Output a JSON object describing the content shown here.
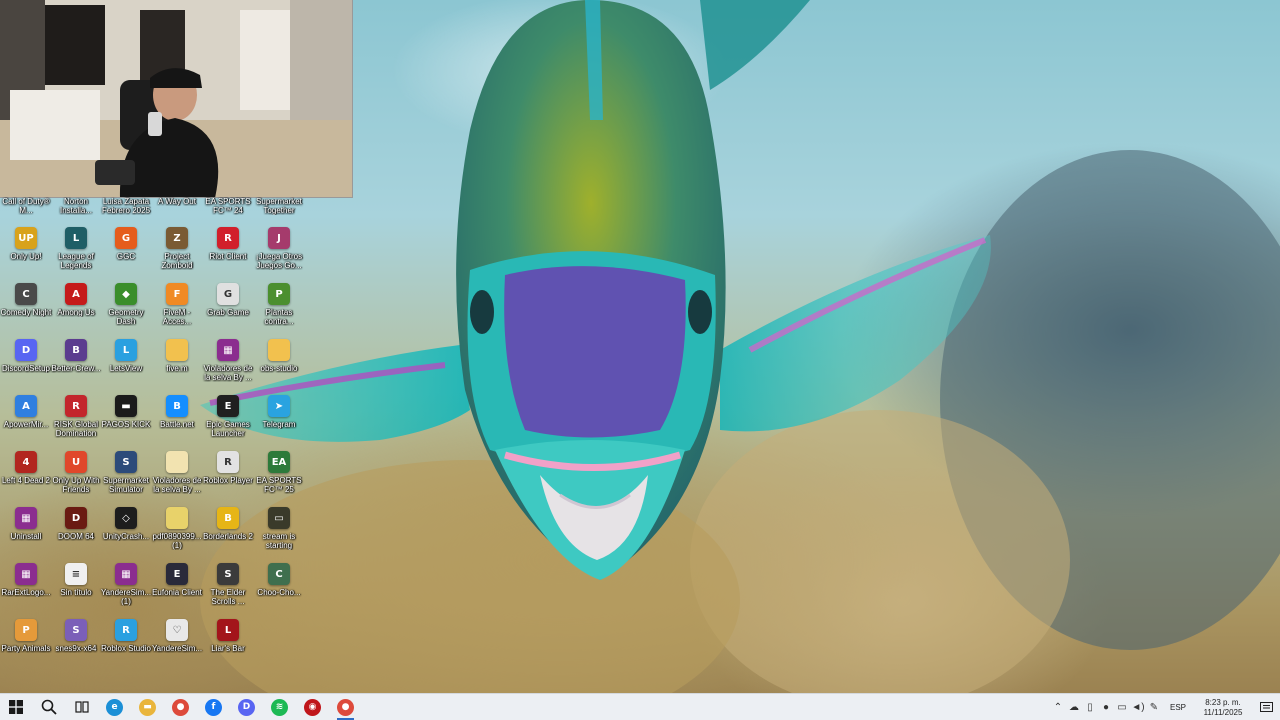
{
  "desktop": {
    "top_row": [
      {
        "label": "Call of Duty® M...",
        "icon": "call-of-duty-icon"
      },
      {
        "label": "Norton Installa...",
        "icon": "norton-icon"
      },
      {
        "label": "Luisa Zapata Febrero 2025",
        "icon": "file-icon"
      },
      {
        "label": "A Way Out",
        "icon": "a-way-out-icon"
      },
      {
        "label": "EA SPORTS FC™ 24",
        "icon": "ea-fc-icon"
      },
      {
        "label": "Supermarket Together",
        "icon": "supermarket-icon"
      }
    ],
    "icons": [
      {
        "label": "Only Up!",
        "icon": "only-up-icon",
        "color": "#d8a21b",
        "glyph": "UP"
      },
      {
        "label": "League of Legends",
        "icon": "league-icon",
        "color": "#1f5e66",
        "glyph": "L"
      },
      {
        "label": "GGC",
        "icon": "ggc-icon",
        "color": "#e55c1c",
        "glyph": "G"
      },
      {
        "label": "Project Zomboid",
        "icon": "zomboid-icon",
        "color": "#7a5a33",
        "glyph": "Z"
      },
      {
        "label": "Riot Client",
        "icon": "riot-icon",
        "color": "#d11f2b",
        "glyph": "R"
      },
      {
        "label": "¡Juega Otros Juegos Go...",
        "icon": "game-icon",
        "color": "#a53b6c",
        "glyph": "J"
      },
      {
        "label": "Comedy Night",
        "icon": "comedy-icon",
        "color": "#4a4a4a",
        "glyph": "C"
      },
      {
        "label": "Among Us",
        "icon": "among-us-icon",
        "color": "#c51a1a",
        "glyph": "A"
      },
      {
        "label": "Geometry Dash",
        "icon": "geometry-dash-icon",
        "color": "#3a8e2b",
        "glyph": "◆"
      },
      {
        "label": "FiveM - Acces...",
        "icon": "fivem-icon",
        "color": "#f08a24",
        "glyph": "F"
      },
      {
        "label": "Grab Game",
        "icon": "grab-game-icon",
        "color": "#e0e0e0",
        "glyph": "G"
      },
      {
        "label": "Plantas contra...",
        "icon": "plants-icon",
        "color": "#4b8f2f",
        "glyph": "P"
      },
      {
        "label": "DiscordSetup",
        "icon": "discord-icon",
        "color": "#5865f2",
        "glyph": "D"
      },
      {
        "label": "Better-Crew...",
        "icon": "better-crew-icon",
        "color": "#5b3c8f",
        "glyph": "B"
      },
      {
        "label": "LetsView",
        "icon": "letsview-icon",
        "color": "#2aa0e0",
        "glyph": "L"
      },
      {
        "label": "five.m",
        "icon": "file-icon",
        "color": "#f2c14e",
        "glyph": ""
      },
      {
        "label": "Violadores de la selva By ...",
        "icon": "archive-icon",
        "color": "#8b2d8f",
        "glyph": "▦"
      },
      {
        "label": "obs-studio",
        "icon": "folder-icon",
        "color": "#f2c14e",
        "glyph": ""
      },
      {
        "label": "ApowerMir...",
        "icon": "apowermirror-icon",
        "color": "#2f7fe0",
        "glyph": "A"
      },
      {
        "label": "RISK Global Domination",
        "icon": "risk-icon",
        "color": "#c3262c",
        "glyph": "R"
      },
      {
        "label": "PAGOS KICK",
        "icon": "kick-icon",
        "color": "#1b1b1b",
        "glyph": "▬"
      },
      {
        "label": "Battle.net",
        "icon": "battlenet-icon",
        "color": "#148eff",
        "glyph": "B"
      },
      {
        "label": "Epic Games Launcher",
        "icon": "epic-icon",
        "color": "#202020",
        "glyph": "E"
      },
      {
        "label": "Telegram",
        "icon": "telegram-icon",
        "color": "#2aa3e0",
        "glyph": "➤"
      },
      {
        "label": "Left 4 Dead 2",
        "icon": "left4dead-icon",
        "color": "#b2261f",
        "glyph": "4"
      },
      {
        "label": "Only Up With Friends",
        "icon": "only-up-friends-icon",
        "color": "#e0472b",
        "glyph": "U"
      },
      {
        "label": "Supermarket Simulator",
        "icon": "supermarket-sim-icon",
        "color": "#2c4b7a",
        "glyph": "S"
      },
      {
        "label": "Violadores de la selva By ...",
        "icon": "file-icon",
        "color": "#f2e3b0",
        "glyph": ""
      },
      {
        "label": "Roblox Player",
        "icon": "roblox-icon",
        "color": "#e2e2e2",
        "glyph": "R"
      },
      {
        "label": "EA SPORTS FC™ 25",
        "icon": "ea-fc-icon",
        "color": "#2d7a3a",
        "glyph": "EA"
      },
      {
        "label": "Uninstall",
        "icon": "uninstall-icon",
        "color": "#8b2d8f",
        "glyph": "▦"
      },
      {
        "label": "DOOM 64",
        "icon": "doom-icon",
        "color": "#6a1a12",
        "glyph": "D"
      },
      {
        "label": "UnityCrash...",
        "icon": "unity-icon",
        "color": "#1d1d1d",
        "glyph": "◇"
      },
      {
        "label": "pdf0890399... (1)",
        "icon": "pdf-icon",
        "color": "#e8d26a",
        "glyph": ""
      },
      {
        "label": "Borderlands 2",
        "icon": "borderlands-icon",
        "color": "#e6b516",
        "glyph": "B"
      },
      {
        "label": "stream is starting",
        "icon": "image-icon",
        "color": "#3a3a2a",
        "glyph": "▭"
      },
      {
        "label": "RarExtLogo...",
        "icon": "rar-icon",
        "color": "#8b2d8f",
        "glyph": "▦"
      },
      {
        "label": "Sin título",
        "icon": "text-file-icon",
        "color": "#f0f0f0",
        "glyph": "≡"
      },
      {
        "label": "YandereSim... (1)",
        "icon": "archive-icon",
        "color": "#8b2d8f",
        "glyph": "▦"
      },
      {
        "label": "Eufonia Client",
        "icon": "eufonia-icon",
        "color": "#2a2a3a",
        "glyph": "E"
      },
      {
        "label": "The Elder Scrolls ...",
        "icon": "elder-scrolls-icon",
        "color": "#3b3b3b",
        "glyph": "S"
      },
      {
        "label": "Choo-Cho...",
        "icon": "choo-choo-icon",
        "color": "#3f6f4e",
        "glyph": "C"
      },
      {
        "label": "Party Animals",
        "icon": "party-animals-icon",
        "color": "#e59a3a",
        "glyph": "P"
      },
      {
        "label": "snes9x-x64",
        "icon": "snes-icon",
        "color": "#7b5fb8",
        "glyph": "S"
      },
      {
        "label": "Roblox Studio",
        "icon": "roblox-studio-icon",
        "color": "#2aa0e0",
        "glyph": "R"
      },
      {
        "label": "YandereSim...",
        "icon": "yandere-icon",
        "color": "#e8e8e8",
        "glyph": "♡"
      },
      {
        "label": "Liar's Bar",
        "icon": "liars-bar-icon",
        "color": "#a3151b",
        "glyph": "L"
      }
    ]
  },
  "taskbar": {
    "start_icon": "windows-start-icon",
    "search_icon": "search-icon",
    "taskview_icon": "task-view-icon",
    "apps": [
      {
        "name": "edge",
        "icon": "edge-icon",
        "color": "#1b8fd6",
        "glyph": "e",
        "running": false
      },
      {
        "name": "file-explorer",
        "icon": "file-explorer-icon",
        "color": "#e9b53c",
        "glyph": "▬",
        "running": false
      },
      {
        "name": "chrome",
        "icon": "chrome-icon",
        "color": "#dd4a3b",
        "glyph": "●",
        "running": false
      },
      {
        "name": "facebook",
        "icon": "facebook-icon",
        "color": "#1877f2",
        "glyph": "f",
        "running": false
      },
      {
        "name": "discord",
        "icon": "discord-icon",
        "color": "#5865f2",
        "glyph": "D",
        "running": false
      },
      {
        "name": "spotify",
        "icon": "spotify-icon",
        "color": "#1db954",
        "glyph": "≋",
        "running": false
      },
      {
        "name": "app-red",
        "icon": "app-icon",
        "color": "#c0161b",
        "glyph": "◉",
        "running": false
      },
      {
        "name": "chrome-2",
        "icon": "chrome-icon",
        "color": "#dd4a3b",
        "glyph": "●",
        "running": true
      }
    ],
    "tray": {
      "language": "ESP",
      "time": "8:23 p. m.",
      "date": "11/11/2025"
    }
  }
}
